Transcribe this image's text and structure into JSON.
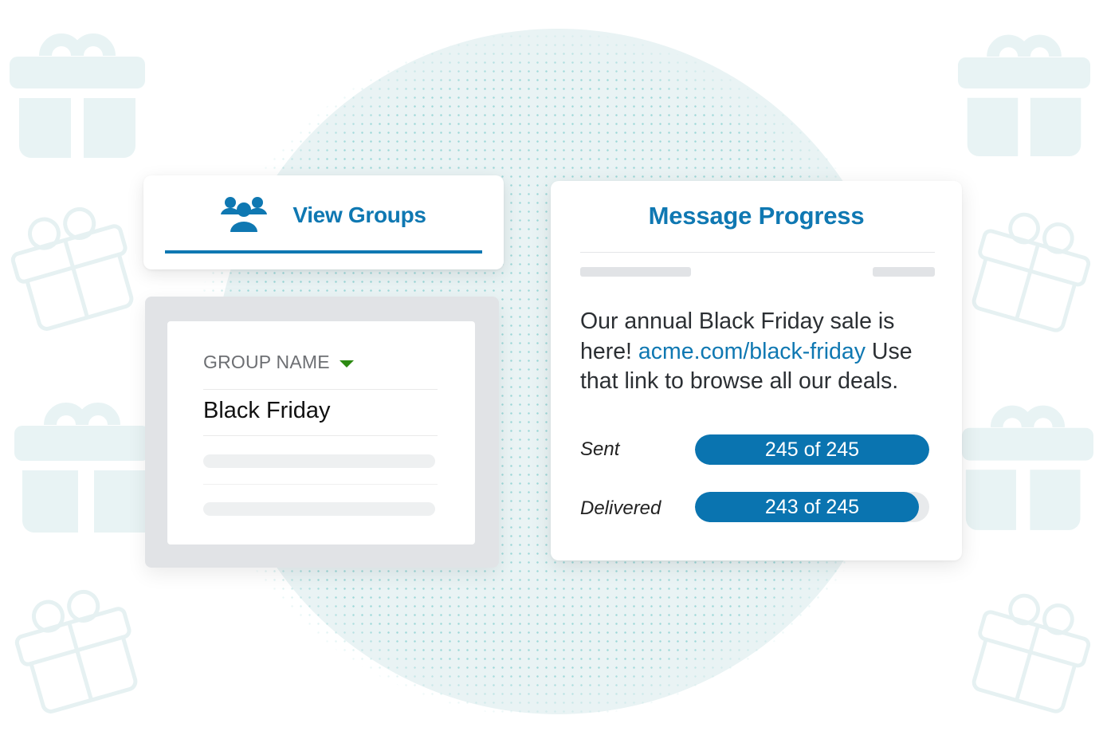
{
  "colors": {
    "brand_blue": "#0f78b2",
    "progress_fill": "#0a74b0",
    "sort_caret": "#2c8a12",
    "gift_icon": "#e8f3f4",
    "background_circle": "#e9f3f4",
    "dot_pattern": "#8fd3d3"
  },
  "decorations": {
    "gift_icons": [
      {
        "style": "solid",
        "side": "left",
        "row": 1
      },
      {
        "style": "outline",
        "side": "left",
        "row": 2
      },
      {
        "style": "solid",
        "side": "left",
        "row": 3
      },
      {
        "style": "outline",
        "side": "left",
        "row": 4
      },
      {
        "style": "solid",
        "side": "right",
        "row": 1
      },
      {
        "style": "outline",
        "side": "right",
        "row": 2
      },
      {
        "style": "solid",
        "side": "right",
        "row": 3
      },
      {
        "style": "outline",
        "side": "right",
        "row": 4
      }
    ]
  },
  "view_groups": {
    "icon": "users-group-icon",
    "label": "View Groups"
  },
  "group_table": {
    "column_header": "GROUP NAME",
    "sort_icon": "caret-down-icon",
    "rows": [
      {
        "name": "Black Friday"
      }
    ],
    "placeholder_rows": 2
  },
  "message_progress": {
    "title": "Message Progress",
    "message": {
      "before_link": "Our annual Black Friday sale is here! ",
      "link_text": "acme.com/black-friday",
      "after_link": " Use that link to browse all our deals."
    },
    "stats": [
      {
        "label": "Sent",
        "value_text": "245 of 245",
        "current": 245,
        "total": 245
      },
      {
        "label": "Delivered",
        "value_text": "243 of 245",
        "current": 243,
        "total": 245
      }
    ]
  }
}
